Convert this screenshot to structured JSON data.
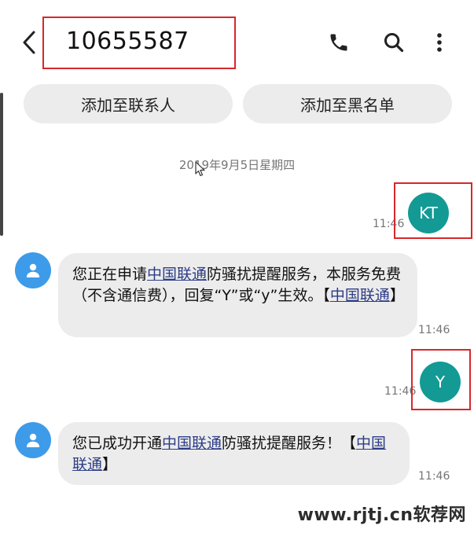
{
  "header": {
    "contact_number": "10655587",
    "back_icon": "chevron-left-icon",
    "call_icon": "phone-icon",
    "search_icon": "search-icon",
    "more_icon": "more-vertical-icon"
  },
  "actions": {
    "add_contact_label": "添加至联系人",
    "block_label": "添加至黑名单"
  },
  "conversation": {
    "date": "2019年9月5日星期四",
    "messages": [
      {
        "direction": "outgoing",
        "text": "KT",
        "time": "11:46"
      },
      {
        "direction": "incoming",
        "parts": [
          "您正在申请",
          "中国联通",
          "防骚扰提醒服务，本服务免费（不含通信费），回复“Y”或“y”生效。【",
          "中国联通",
          "】"
        ],
        "time": "11:46"
      },
      {
        "direction": "outgoing",
        "text": "Y",
        "time": "11:46"
      },
      {
        "direction": "incoming",
        "parts": [
          "您已成功开通",
          "中国联通",
          "防骚扰提醒服务！【",
          "中国联通",
          "】"
        ],
        "time": "11:46"
      }
    ]
  },
  "watermark": "www.rjtj.cn软荐网",
  "colors": {
    "accent_teal": "#139a95",
    "avatar_blue": "#3d9be9",
    "bubble_gray": "#ececec",
    "highlight_red": "#d6282b",
    "link_blue": "#2c3c86"
  }
}
